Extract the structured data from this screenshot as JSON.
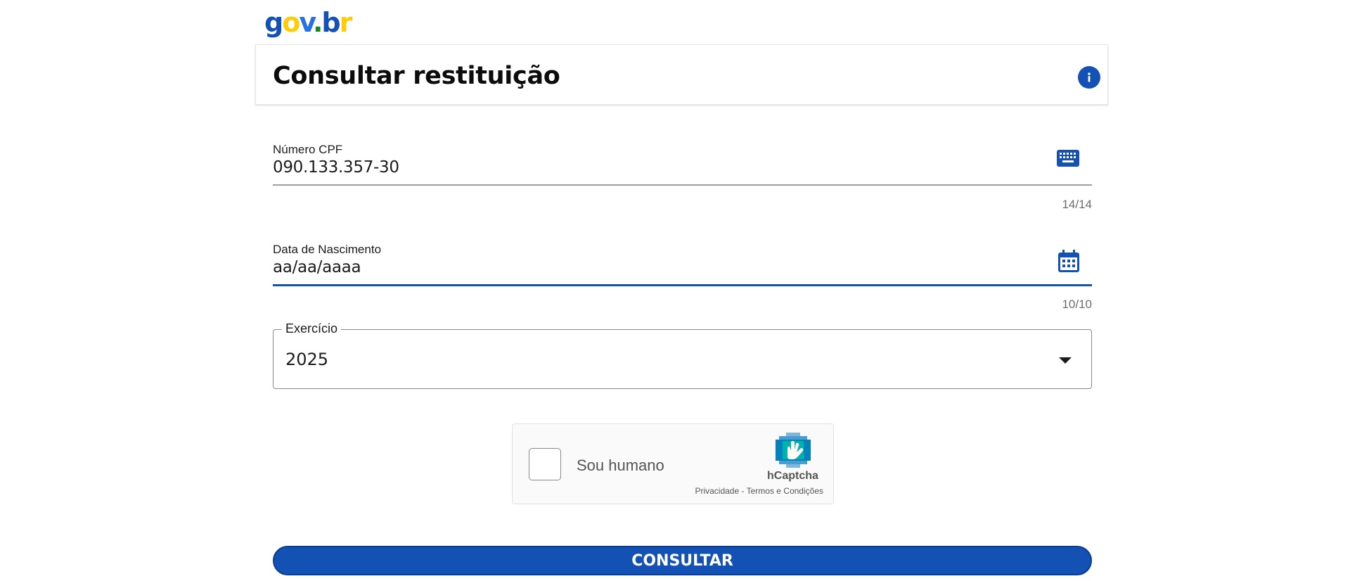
{
  "logo": {
    "text_g": "g",
    "text_o": "o",
    "text_v": "v",
    "text_dot": ".",
    "text_b": "b",
    "text_r": "r"
  },
  "header": {
    "title": "Consultar restituição",
    "info_icon": "info-icon"
  },
  "cpf": {
    "label": "Número CPF",
    "value": "090.133.357-30",
    "counter": "14/14",
    "icon": "keyboard-icon"
  },
  "birth": {
    "label": "Data de Nascimento",
    "value": "aa/aa/aaaa",
    "counter": "10/10",
    "icon": "calendar-icon"
  },
  "exercicio": {
    "label": "Exercício",
    "value": "2025"
  },
  "captcha": {
    "label": "Sou humano",
    "brand": "hCaptcha",
    "privacy": "Privacidade",
    "separator": " - ",
    "terms": "Termos e Condições"
  },
  "submit": {
    "label": "CONSULTAR"
  },
  "colors": {
    "primary": "#1351b4",
    "text": "#1b1b1b",
    "muted": "#6b6b6b"
  }
}
